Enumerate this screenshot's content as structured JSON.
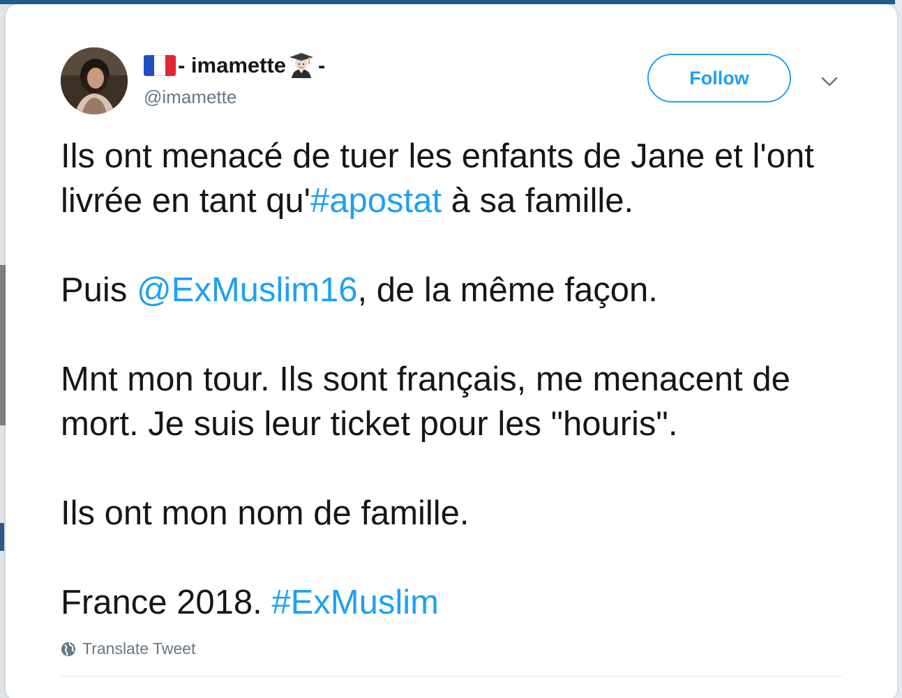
{
  "tweet": {
    "author": {
      "display_name": "- imamette",
      "name_suffix": "-",
      "name_prefix_icon": "france-flag-icon",
      "name_emoji_icon": "woman-student-icon",
      "handle": "@imamette",
      "avatar": "profile-photo"
    },
    "follow_label": "Follow",
    "menu_icon": "chevron-down-icon",
    "lines": {
      "p1_a": "Ils ont menacé de tuer les enfants de Jane et l'ont livrée en tant qu'",
      "p1_link": "#apostat",
      "p1_b": " à sa famille.",
      "p2_a": "Puis ",
      "p2_link": "@ExMuslim16",
      "p2_b": ", de la même façon.",
      "p3": "Mnt mon tour. Ils sont français, me menacent de mort. Je suis leur ticket pour les \"houris\".",
      "p4": "Ils ont mon nom de famille.",
      "p5_a": "France 2018. ",
      "p5_link": "#ExMuslim"
    },
    "translate_label": "Translate Tweet",
    "translate_icon": "globe-icon"
  },
  "colors": {
    "link": "#1da1f2",
    "text": "#14171a",
    "secondary": "#657786",
    "flag_blue": "#1f4fc0",
    "flag_white": "#ffffff",
    "flag_red": "#e52432"
  }
}
